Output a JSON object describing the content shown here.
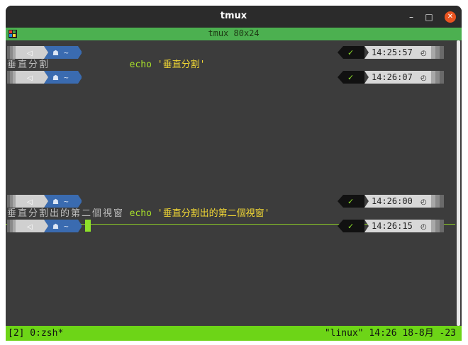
{
  "window": {
    "title": "tmux"
  },
  "tab": {
    "title": "tmux 80x24"
  },
  "colors": {
    "accent_green": "#6dd517",
    "tab_green": "#4cb050",
    "path_blue": "#3a6bb0",
    "time_bg": "#d8d8d8",
    "cmd_green": "#a8e02a",
    "string_yellow": "#f2d835"
  },
  "prompt": {
    "home_icon": "home-icon",
    "path": "~",
    "check": "✓",
    "clock_icon": "clock-icon"
  },
  "panes": [
    {
      "lines": [
        {
          "cmd": "echo",
          "arg": "'垂直分割'",
          "time": "14:25:57"
        },
        {
          "output": "垂直分割"
        },
        {
          "cmd": "",
          "arg": "",
          "time": "14:26:07"
        }
      ]
    },
    {
      "lines": [
        {
          "cmd": "echo",
          "arg": "'垂直分割出的第二個視窗'",
          "time": "14:26:00"
        },
        {
          "output": "垂直分割出的第二個視窗"
        },
        {
          "cmd": "",
          "arg": "",
          "time": "14:26:15"
        }
      ]
    }
  ],
  "status": {
    "left": "[2] 0:zsh*",
    "right": "\"linux\" 14:26 18-8月 -23"
  }
}
